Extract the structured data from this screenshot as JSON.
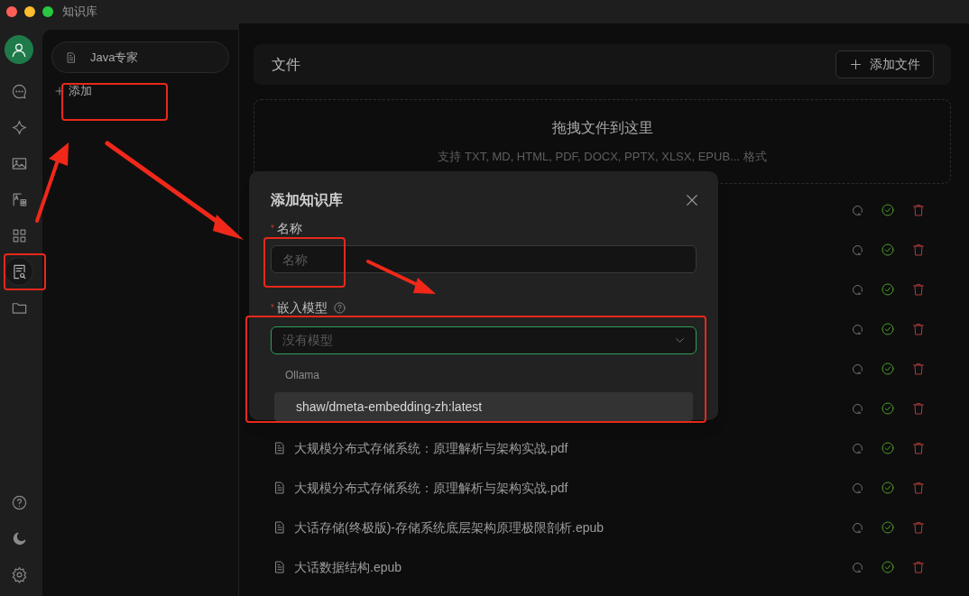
{
  "window": {
    "title": "知识库"
  },
  "rail": [
    {
      "selected": false
    },
    {
      "selected": false
    },
    {
      "selected": false
    },
    {
      "selected": false
    },
    {
      "selected": false
    },
    {
      "selected": false
    },
    {
      "selected": true
    },
    {
      "selected": false
    }
  ],
  "knowledge_bases": [
    {
      "label": "Java专家",
      "selected": true
    }
  ],
  "add_button": "添加",
  "files_header": {
    "title": "文件",
    "add_button": "添加文件"
  },
  "dropzone": {
    "title": "拖拽文件到这里",
    "hint": "支持 TXT, MD, HTML, PDF, DOCX, PPTX, XLSX, EPUB... 格式"
  },
  "files": [
    {
      "kind": "covered"
    },
    {
      "kind": "covered"
    },
    {
      "kind": "covered"
    },
    {
      "kind": "covered"
    },
    {
      "kind": "covered"
    },
    {
      "kind": "covered"
    },
    {
      "kind": "file",
      "name": "大规模分布式存储系统：原理解析与架构实战.pdf"
    },
    {
      "kind": "file",
      "name": "大规模分布式存储系统：原理解析与架构实战.pdf"
    },
    {
      "kind": "file",
      "name": "大话存储(终极版)-存储系统底层架构原理极限剖析.epub"
    },
    {
      "kind": "file",
      "name": "大话数据结构.epub"
    }
  ],
  "dialog": {
    "title": "添加知识库",
    "name_field": {
      "label": "名称",
      "required_mark": "*",
      "placeholder": "名称"
    },
    "model_field": {
      "label": "嵌入模型",
      "required_mark": "*",
      "placeholder": "没有模型",
      "focused": true
    },
    "dropdown": {
      "group": "Ollama",
      "options": [
        {
          "label": "shaw/dmeta-embedding-zh:latest",
          "selected": true
        }
      ]
    }
  }
}
